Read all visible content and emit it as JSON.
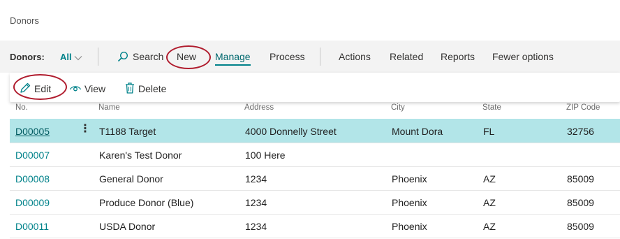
{
  "page": {
    "title": "Donors"
  },
  "actionbar": {
    "label": "Donors:",
    "filter": "All",
    "search": "Search",
    "new": "New",
    "manage": "Manage",
    "process": "Process",
    "actions": "Actions",
    "related": "Related",
    "reports": "Reports",
    "fewer_options": "Fewer options"
  },
  "manage_menu": {
    "edit": "Edit",
    "view": "View",
    "delete": "Delete"
  },
  "table": {
    "columns": [
      "No.",
      "Name",
      "Address",
      "City",
      "State",
      "ZIP Code"
    ],
    "rows": [
      {
        "no": "D00005",
        "name": "T1188 Target",
        "address": "4000 Donnelly Street",
        "city": "Mount Dora",
        "state": "FL",
        "zip": "32756"
      },
      {
        "no": "D00007",
        "name": "Karen's Test Donor",
        "address": "100 Here",
        "city": "",
        "state": "",
        "zip": ""
      },
      {
        "no": "D00008",
        "name": "General Donor",
        "address": "1234",
        "city": "Phoenix",
        "state": "AZ",
        "zip": "85009"
      },
      {
        "no": "D00009",
        "name": "Produce Donor (Blue)",
        "address": "1234",
        "city": "Phoenix",
        "state": "AZ",
        "zip": "85009"
      },
      {
        "no": "D00011",
        "name": "USDA Donor",
        "address": "1234",
        "city": "Phoenix",
        "state": "AZ",
        "zip": "85009"
      }
    ],
    "selected_row": 0
  },
  "colors": {
    "accent": "#00828a",
    "selected_row": "#b2e5e8",
    "annotation": "#b01c2e"
  }
}
